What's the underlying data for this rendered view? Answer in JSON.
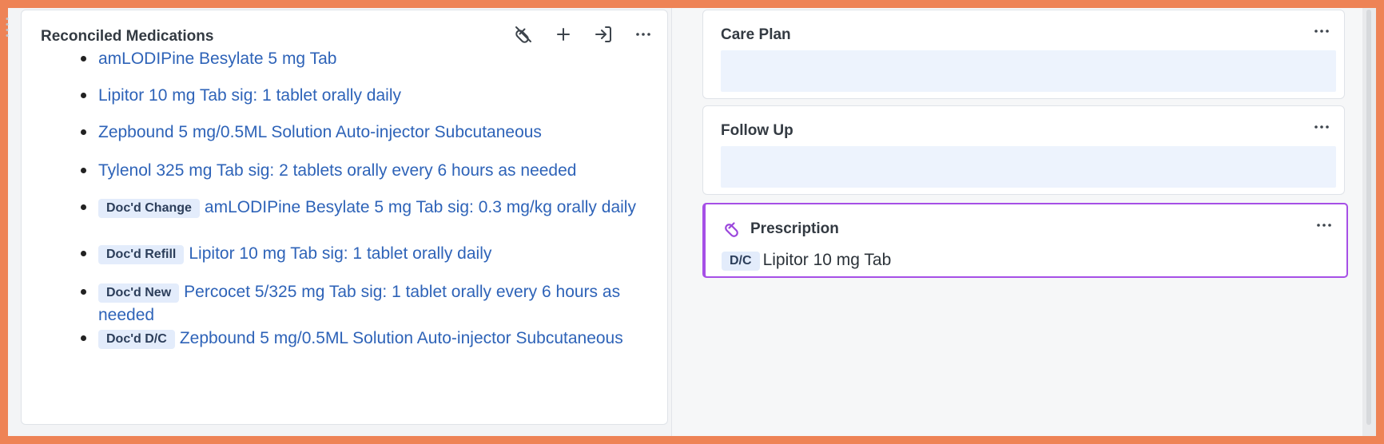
{
  "colors": {
    "frame_border": "#ee8356",
    "link": "#2e63b8",
    "badge_bg": "#e3ecfb",
    "prescription_accent": "#a64fe6"
  },
  "reconciled_medications": {
    "title": "Reconciled Medications",
    "toolbar": {
      "icons": [
        "pill-slash-icon",
        "plus-icon",
        "sign-in-icon",
        "more-horizontal-icon"
      ]
    },
    "items": [
      {
        "badge": "",
        "text": "amLODIPine Besylate 5 mg Tab"
      },
      {
        "badge": "",
        "text": "Lipitor 10 mg Tab sig: 1 tablet orally daily"
      },
      {
        "badge": "",
        "text": "Zepbound 5 mg/0.5ML Solution Auto-injector Subcutaneous"
      },
      {
        "badge": "",
        "text": "Tylenol 325 mg Tab sig: 2 tablets orally every 6 hours as needed"
      },
      {
        "badge": "Doc'd Change",
        "text": "amLODIPine Besylate 5 mg Tab sig: 0.3 mg/kg orally daily"
      },
      {
        "badge": "Doc'd Refill",
        "text": "Lipitor 10 mg Tab sig: 1 tablet orally daily"
      },
      {
        "badge": "Doc'd New",
        "text": "Percocet 5/325 mg Tab sig: 1 tablet orally every 6 hours as needed"
      },
      {
        "badge": "Doc'd D/C",
        "text": "Zepbound 5 mg/0.5ML Solution Auto-injector Subcutaneous"
      }
    ]
  },
  "care_plan": {
    "title": "Care Plan",
    "value": ""
  },
  "follow_up": {
    "title": "Follow Up",
    "value": ""
  },
  "prescription": {
    "title": "Prescription",
    "badge": "D/C",
    "text": "Lipitor 10 mg Tab"
  }
}
